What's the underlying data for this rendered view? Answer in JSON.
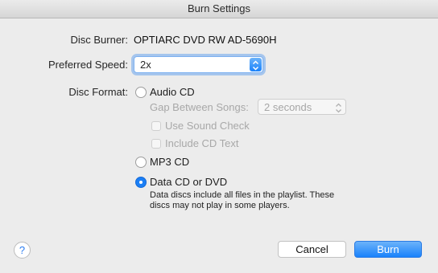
{
  "window": {
    "title": "Burn Settings"
  },
  "disc_burner": {
    "label": "Disc Burner:",
    "value": "OPTIARC DVD RW AD-5690H"
  },
  "preferred_speed": {
    "label": "Preferred Speed:",
    "value": "2x"
  },
  "disc_format": {
    "label": "Disc Format:",
    "audio_cd": {
      "label": "Audio CD",
      "selected": false
    },
    "gap_between_songs": {
      "label": "Gap Between Songs:",
      "value": "2 seconds",
      "enabled": false
    },
    "use_sound_check": {
      "label": "Use Sound Check",
      "checked": false,
      "enabled": false
    },
    "include_cd_text": {
      "label": "Include CD Text",
      "checked": false,
      "enabled": false
    },
    "mp3_cd": {
      "label": "MP3 CD",
      "selected": false
    },
    "data_cd_dvd": {
      "label": "Data CD or DVD",
      "selected": true
    },
    "data_note_line1": "Data discs include all files in the playlist. These",
    "data_note_line2": "discs may not play in some players."
  },
  "buttons": {
    "help": "?",
    "cancel": "Cancel",
    "burn": "Burn"
  },
  "colors": {
    "accent": "#1b7ff5",
    "window_bg": "#ececec",
    "disabled_text": "#a8a8a8"
  },
  "icons": {
    "stepper": "up-down-chevron-icon",
    "help": "question-mark-icon"
  }
}
